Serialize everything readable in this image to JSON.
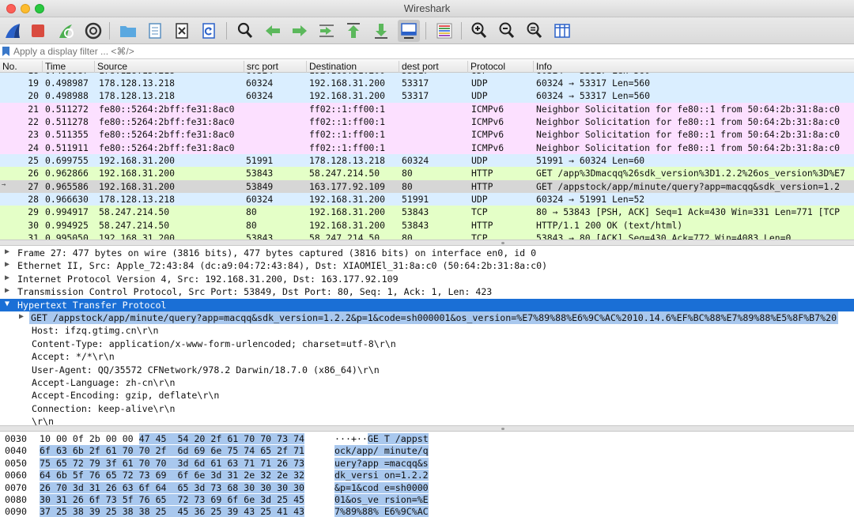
{
  "window": {
    "title": "Wireshark"
  },
  "toolbar": {
    "buttons": [
      {
        "name": "start-capture-icon",
        "color": "#2a61c9"
      },
      {
        "name": "stop-capture-icon",
        "color": "#d94b3f"
      },
      {
        "name": "restart-capture-icon",
        "color": "#4caf50"
      },
      {
        "name": "capture-options-icon",
        "color": "#333333"
      },
      {
        "name": "open-file-icon",
        "color": "#5aa8e0"
      },
      {
        "name": "save-file-icon",
        "color": "#5a8fc0"
      },
      {
        "name": "close-file-icon",
        "color": "#333333"
      },
      {
        "name": "reload-file-icon",
        "color": "#2a61c9"
      },
      {
        "name": "find-packet-icon",
        "color": "#222222"
      },
      {
        "name": "go-back-icon",
        "color": "#5cb85c"
      },
      {
        "name": "go-forward-icon",
        "color": "#5cb85c"
      },
      {
        "name": "go-to-packet-icon",
        "color": "#5cb85c"
      },
      {
        "name": "go-first-icon",
        "color": "#5cb85c"
      },
      {
        "name": "go-last-icon",
        "color": "#5cb85c"
      },
      {
        "name": "autoscroll-icon",
        "color": "#2a61c9"
      },
      {
        "name": "colorize-icon",
        "color": "#888888"
      },
      {
        "name": "zoom-in-icon",
        "color": "#222222"
      },
      {
        "name": "zoom-out-icon",
        "color": "#222222"
      },
      {
        "name": "zoom-normal-icon",
        "color": "#222222"
      },
      {
        "name": "resize-columns-icon",
        "color": "#2a61c9"
      }
    ]
  },
  "filter": {
    "placeholder": "Apply a display filter ... <⌘/>"
  },
  "packet_list": {
    "columns": [
      "No.",
      "Time",
      "Source",
      "src port",
      "Destination",
      "dest port",
      "Protocol",
      "Info"
    ],
    "top_partial": {
      "no": "18",
      "time": "0.498987",
      "src": "178.128.13.218",
      "sport": "60324",
      "dst": "192.168.31.200",
      "dport": "53317",
      "proto": "UDP",
      "info": "60324 → 53317 Len=560",
      "color": "#daeeff"
    },
    "rows": [
      {
        "no": "19",
        "time": "0.498987",
        "src": "178.128.13.218",
        "sport": "60324",
        "dst": "192.168.31.200",
        "dport": "53317",
        "proto": "UDP",
        "info": "60324 → 53317 Len=560",
        "color": "#daeeff"
      },
      {
        "no": "20",
        "time": "0.498988",
        "src": "178.128.13.218",
        "sport": "60324",
        "dst": "192.168.31.200",
        "dport": "53317",
        "proto": "UDP",
        "info": "60324 → 53317 Len=560",
        "color": "#daeeff"
      },
      {
        "no": "21",
        "time": "0.511272",
        "src": "fe80::5264:2bff:fe31:8ac0",
        "sport": "",
        "dst": "ff02::1:ff00:1",
        "dport": "",
        "proto": "ICMPv6",
        "info": "Neighbor Solicitation for fe80::1 from 50:64:2b:31:8a:c0",
        "color": "#fce0ff"
      },
      {
        "no": "22",
        "time": "0.511278",
        "src": "fe80::5264:2bff:fe31:8ac0",
        "sport": "",
        "dst": "ff02::1:ff00:1",
        "dport": "",
        "proto": "ICMPv6",
        "info": "Neighbor Solicitation for fe80::1 from 50:64:2b:31:8a:c0",
        "color": "#fce0ff"
      },
      {
        "no": "23",
        "time": "0.511355",
        "src": "fe80::5264:2bff:fe31:8ac0",
        "sport": "",
        "dst": "ff02::1:ff00:1",
        "dport": "",
        "proto": "ICMPv6",
        "info": "Neighbor Solicitation for fe80::1 from 50:64:2b:31:8a:c0",
        "color": "#fce0ff"
      },
      {
        "no": "24",
        "time": "0.511911",
        "src": "fe80::5264:2bff:fe31:8ac0",
        "sport": "",
        "dst": "ff02::1:ff00:1",
        "dport": "",
        "proto": "ICMPv6",
        "info": "Neighbor Solicitation for fe80::1 from 50:64:2b:31:8a:c0",
        "color": "#fce0ff"
      },
      {
        "no": "25",
        "time": "0.699755",
        "src": "192.168.31.200",
        "sport": "51991",
        "dst": "178.128.13.218",
        "dport": "60324",
        "proto": "UDP",
        "info": "51991 → 60324 Len=60",
        "color": "#daeeff"
      },
      {
        "no": "26",
        "time": "0.962866",
        "src": "192.168.31.200",
        "sport": "53843",
        "dst": "58.247.214.50",
        "dport": "80",
        "proto": "HTTP",
        "info": "GET /app%3Dmacqq%26sdk_version%3D1.2.2%26os_version%3D%E7",
        "color": "#e4ffc7"
      },
      {
        "no": "27",
        "time": "0.965586",
        "src": "192.168.31.200",
        "sport": "53849",
        "dst": "163.177.92.109",
        "dport": "80",
        "proto": "HTTP",
        "info": "GET /appstock/app/minute/query?app=macqq&sdk_version=1.2",
        "color": "#d6d6d6",
        "selected": true
      },
      {
        "no": "28",
        "time": "0.966630",
        "src": "178.128.13.218",
        "sport": "60324",
        "dst": "192.168.31.200",
        "dport": "51991",
        "proto": "UDP",
        "info": "60324 → 51991 Len=52",
        "color": "#daeeff"
      },
      {
        "no": "29",
        "time": "0.994917",
        "src": "58.247.214.50",
        "sport": "80",
        "dst": "192.168.31.200",
        "dport": "53843",
        "proto": "TCP",
        "info": "80 → 53843 [PSH, ACK] Seq=1 Ack=430 Win=331 Len=771 [TCP",
        "color": "#e4ffc7"
      },
      {
        "no": "30",
        "time": "0.994925",
        "src": "58.247.214.50",
        "sport": "80",
        "dst": "192.168.31.200",
        "dport": "53843",
        "proto": "HTTP",
        "info": "HTTP/1.1 200 OK  (text/html)",
        "color": "#e4ffc7"
      },
      {
        "no": "31",
        "time": "0.995050",
        "src": "192.168.31.200",
        "sport": "53843",
        "dst": "58.247.214.50",
        "dport": "80",
        "proto": "TCP",
        "info": "53843 → 80 [ACK] Seq=430 Ack=772 Win=4083 Len=0",
        "color": "#e4ffc7"
      }
    ]
  },
  "details": {
    "lines": [
      {
        "text": "Frame 27: 477 bytes on wire (3816 bits), 477 bytes captured (3816 bits) on interface en0, id 0",
        "indent": 0,
        "arrow": "▶"
      },
      {
        "text": "Ethernet II, Src: Apple_72:43:84 (dc:a9:04:72:43:84), Dst: XIAOMIEl_31:8a:c0 (50:64:2b:31:8a:c0)",
        "indent": 0,
        "arrow": "▶"
      },
      {
        "text": "Internet Protocol Version 4, Src: 192.168.31.200, Dst: 163.177.92.109",
        "indent": 0,
        "arrow": "▶"
      },
      {
        "text": "Transmission Control Protocol, Src Port: 53849, Dst Port: 80, Seq: 1, Ack: 1, Len: 423",
        "indent": 0,
        "arrow": "▶"
      },
      {
        "text": "Hypertext Transfer Protocol",
        "indent": 0,
        "arrow": "▼",
        "selected": true
      },
      {
        "text": "GET /appstock/app/minute/query?app=macqq&sdk_version=1.2.2&p=1&code=sh000001&os_version=%E7%89%88%E6%9C%AC%2010.14.6%EF%BC%88%E7%89%88%E5%8F%B7%20",
        "indent": 1,
        "arrow": "▶",
        "highlight": true
      },
      {
        "text": "Host: ifzq.gtimg.cn\\r\\n",
        "indent": 1,
        "arrow": ""
      },
      {
        "text": "Content-Type: application/x-www-form-urlencoded; charset=utf-8\\r\\n",
        "indent": 1,
        "arrow": ""
      },
      {
        "text": "Accept: */*\\r\\n",
        "indent": 1,
        "arrow": ""
      },
      {
        "text": "User-Agent: QQ/35572 CFNetwork/978.2 Darwin/18.7.0 (x86_64)\\r\\n",
        "indent": 1,
        "arrow": ""
      },
      {
        "text": "Accept-Language: zh-cn\\r\\n",
        "indent": 1,
        "arrow": ""
      },
      {
        "text": "Accept-Encoding: gzip, deflate\\r\\n",
        "indent": 1,
        "arrow": ""
      },
      {
        "text": "Connection: keep-alive\\r\\n",
        "indent": 1,
        "arrow": ""
      },
      {
        "text": "\\r\\n",
        "indent": 1,
        "arrow": ""
      }
    ]
  },
  "bytes": {
    "rows": [
      {
        "off": "0030",
        "hex_plain": "10 00 0f 2b 00 00 ",
        "hex_hl": "47 45  54 20 2f 61 70 70 73 74",
        "asc_plain": "···+··",
        "asc_hl": "GE T /appst"
      },
      {
        "off": "0040",
        "hex_plain": "",
        "hex_hl": "6f 63 6b 2f 61 70 70 2f  6d 69 6e 75 74 65 2f 71",
        "asc_plain": "",
        "asc_hl": "ock/app/ minute/q"
      },
      {
        "off": "0050",
        "hex_plain": "",
        "hex_hl": "75 65 72 79 3f 61 70 70  3d 6d 61 63 71 71 26 73",
        "asc_plain": "",
        "asc_hl": "uery?app =macqq&s"
      },
      {
        "off": "0060",
        "hex_plain": "",
        "hex_hl": "64 6b 5f 76 65 72 73 69  6f 6e 3d 31 2e 32 2e 32",
        "asc_plain": "",
        "asc_hl": "dk_versi on=1.2.2"
      },
      {
        "off": "0070",
        "hex_plain": "",
        "hex_hl": "26 70 3d 31 26 63 6f 64  65 3d 73 68 30 30 30 30",
        "asc_plain": "",
        "asc_hl": "&p=1&cod e=sh0000"
      },
      {
        "off": "0080",
        "hex_plain": "",
        "hex_hl": "30 31 26 6f 73 5f 76 65  72 73 69 6f 6e 3d 25 45",
        "asc_plain": "",
        "asc_hl": "01&os_ve rsion=%E"
      },
      {
        "off": "0090",
        "hex_plain": "",
        "hex_hl": "37 25 38 39 25 38 38 25  45 36 25 39 43 25 41 43",
        "asc_plain": "",
        "asc_hl": "7%89%88% E6%9C%AC"
      },
      {
        "off": "00a0",
        "hex_plain": "",
        "hex_hl": "25 32 30 31 30 2e 31 34  2e 36 25 45 46 25 42 43",
        "asc_plain": "",
        "asc_hl": "%2010.14 .6%EF%BC"
      }
    ]
  }
}
